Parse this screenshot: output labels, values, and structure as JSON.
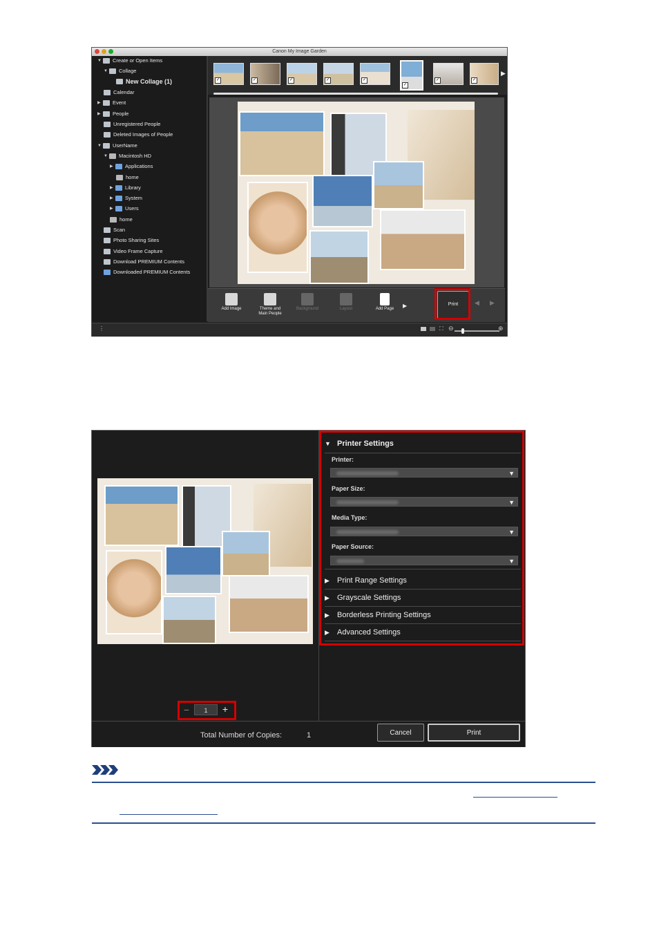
{
  "screenshot1": {
    "window_title": "Canon My Image Garden",
    "sidebar": {
      "items": [
        {
          "label": "Create or Open Items",
          "icon": "create-items-icon"
        },
        {
          "label": "Collage",
          "icon": "collage-icon"
        },
        {
          "label": "New Collage (1)",
          "icon": "collage-item-icon"
        },
        {
          "label": "Calendar",
          "icon": "calendar-icon"
        },
        {
          "label": "Event",
          "icon": "event-icon"
        },
        {
          "label": "People",
          "icon": "people-icon"
        },
        {
          "label": "Unregistered People",
          "icon": "unregistered-people-icon"
        },
        {
          "label": "Deleted Images of People",
          "icon": "deleted-people-icon"
        },
        {
          "label": "UserName",
          "icon": "user-icon"
        },
        {
          "label": "Macintosh HD",
          "icon": "drive-icon"
        },
        {
          "label": "Applications",
          "icon": "folder-icon"
        },
        {
          "label": "home",
          "icon": "drive-icon"
        },
        {
          "label": "Library",
          "icon": "folder-icon"
        },
        {
          "label": "System",
          "icon": "folder-icon"
        },
        {
          "label": "Users",
          "icon": "folder-icon"
        },
        {
          "label": "home",
          "icon": "drive-icon"
        },
        {
          "label": "Scan",
          "icon": "scan-icon"
        },
        {
          "label": "Photo Sharing Sites",
          "icon": "photo-sharing-icon"
        },
        {
          "label": "Video Frame Capture",
          "icon": "video-frame-icon"
        },
        {
          "label": "Download PREMIUM Contents",
          "icon": "download-premium-icon"
        },
        {
          "label": "Downloaded PREMIUM Contents",
          "icon": "downloaded-premium-icon"
        }
      ]
    },
    "toolbar": {
      "add_image": "Add Image",
      "theme_line1": "Theme and",
      "theme_line2": "Main People",
      "background": "Background",
      "layout": "Layout",
      "add_page": "Add Page",
      "print": "Print"
    }
  },
  "screenshot2": {
    "sections": {
      "printer_settings": "Printer Settings",
      "print_range": "Print Range Settings",
      "grayscale": "Grayscale Settings",
      "borderless": "Borderless Printing Settings",
      "advanced": "Advanced Settings"
    },
    "fields": {
      "printer": "Printer:",
      "paper_size": "Paper Size:",
      "media_type": "Media Type:",
      "paper_source": "Paper Source:"
    },
    "copies": "1",
    "total_label": "Total Number of Copies:",
    "total_value": "1",
    "cancel": "Cancel",
    "print": "Print"
  },
  "colors": {
    "highlight": "#d40000",
    "note_rule": "#2a4d8f"
  }
}
